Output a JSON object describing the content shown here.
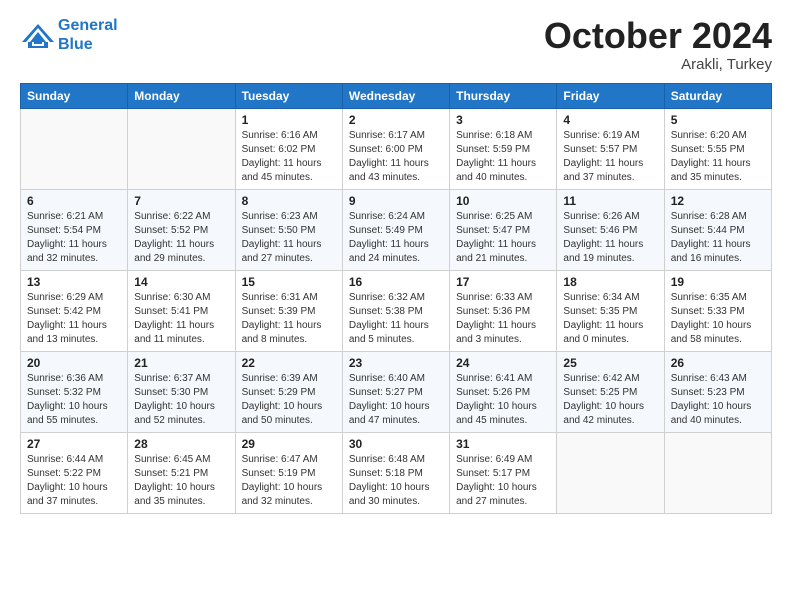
{
  "header": {
    "logo_line1": "General",
    "logo_line2": "Blue",
    "month_title": "October 2024",
    "location": "Arakli, Turkey"
  },
  "columns": [
    "Sunday",
    "Monday",
    "Tuesday",
    "Wednesday",
    "Thursday",
    "Friday",
    "Saturday"
  ],
  "weeks": [
    [
      {
        "day": "",
        "info": ""
      },
      {
        "day": "",
        "info": ""
      },
      {
        "day": "1",
        "info": "Sunrise: 6:16 AM\nSunset: 6:02 PM\nDaylight: 11 hours and 45 minutes."
      },
      {
        "day": "2",
        "info": "Sunrise: 6:17 AM\nSunset: 6:00 PM\nDaylight: 11 hours and 43 minutes."
      },
      {
        "day": "3",
        "info": "Sunrise: 6:18 AM\nSunset: 5:59 PM\nDaylight: 11 hours and 40 minutes."
      },
      {
        "day": "4",
        "info": "Sunrise: 6:19 AM\nSunset: 5:57 PM\nDaylight: 11 hours and 37 minutes."
      },
      {
        "day": "5",
        "info": "Sunrise: 6:20 AM\nSunset: 5:55 PM\nDaylight: 11 hours and 35 minutes."
      }
    ],
    [
      {
        "day": "6",
        "info": "Sunrise: 6:21 AM\nSunset: 5:54 PM\nDaylight: 11 hours and 32 minutes."
      },
      {
        "day": "7",
        "info": "Sunrise: 6:22 AM\nSunset: 5:52 PM\nDaylight: 11 hours and 29 minutes."
      },
      {
        "day": "8",
        "info": "Sunrise: 6:23 AM\nSunset: 5:50 PM\nDaylight: 11 hours and 27 minutes."
      },
      {
        "day": "9",
        "info": "Sunrise: 6:24 AM\nSunset: 5:49 PM\nDaylight: 11 hours and 24 minutes."
      },
      {
        "day": "10",
        "info": "Sunrise: 6:25 AM\nSunset: 5:47 PM\nDaylight: 11 hours and 21 minutes."
      },
      {
        "day": "11",
        "info": "Sunrise: 6:26 AM\nSunset: 5:46 PM\nDaylight: 11 hours and 19 minutes."
      },
      {
        "day": "12",
        "info": "Sunrise: 6:28 AM\nSunset: 5:44 PM\nDaylight: 11 hours and 16 minutes."
      }
    ],
    [
      {
        "day": "13",
        "info": "Sunrise: 6:29 AM\nSunset: 5:42 PM\nDaylight: 11 hours and 13 minutes."
      },
      {
        "day": "14",
        "info": "Sunrise: 6:30 AM\nSunset: 5:41 PM\nDaylight: 11 hours and 11 minutes."
      },
      {
        "day": "15",
        "info": "Sunrise: 6:31 AM\nSunset: 5:39 PM\nDaylight: 11 hours and 8 minutes."
      },
      {
        "day": "16",
        "info": "Sunrise: 6:32 AM\nSunset: 5:38 PM\nDaylight: 11 hours and 5 minutes."
      },
      {
        "day": "17",
        "info": "Sunrise: 6:33 AM\nSunset: 5:36 PM\nDaylight: 11 hours and 3 minutes."
      },
      {
        "day": "18",
        "info": "Sunrise: 6:34 AM\nSunset: 5:35 PM\nDaylight: 11 hours and 0 minutes."
      },
      {
        "day": "19",
        "info": "Sunrise: 6:35 AM\nSunset: 5:33 PM\nDaylight: 10 hours and 58 minutes."
      }
    ],
    [
      {
        "day": "20",
        "info": "Sunrise: 6:36 AM\nSunset: 5:32 PM\nDaylight: 10 hours and 55 minutes."
      },
      {
        "day": "21",
        "info": "Sunrise: 6:37 AM\nSunset: 5:30 PM\nDaylight: 10 hours and 52 minutes."
      },
      {
        "day": "22",
        "info": "Sunrise: 6:39 AM\nSunset: 5:29 PM\nDaylight: 10 hours and 50 minutes."
      },
      {
        "day": "23",
        "info": "Sunrise: 6:40 AM\nSunset: 5:27 PM\nDaylight: 10 hours and 47 minutes."
      },
      {
        "day": "24",
        "info": "Sunrise: 6:41 AM\nSunset: 5:26 PM\nDaylight: 10 hours and 45 minutes."
      },
      {
        "day": "25",
        "info": "Sunrise: 6:42 AM\nSunset: 5:25 PM\nDaylight: 10 hours and 42 minutes."
      },
      {
        "day": "26",
        "info": "Sunrise: 6:43 AM\nSunset: 5:23 PM\nDaylight: 10 hours and 40 minutes."
      }
    ],
    [
      {
        "day": "27",
        "info": "Sunrise: 6:44 AM\nSunset: 5:22 PM\nDaylight: 10 hours and 37 minutes."
      },
      {
        "day": "28",
        "info": "Sunrise: 6:45 AM\nSunset: 5:21 PM\nDaylight: 10 hours and 35 minutes."
      },
      {
        "day": "29",
        "info": "Sunrise: 6:47 AM\nSunset: 5:19 PM\nDaylight: 10 hours and 32 minutes."
      },
      {
        "day": "30",
        "info": "Sunrise: 6:48 AM\nSunset: 5:18 PM\nDaylight: 10 hours and 30 minutes."
      },
      {
        "day": "31",
        "info": "Sunrise: 6:49 AM\nSunset: 5:17 PM\nDaylight: 10 hours and 27 minutes."
      },
      {
        "day": "",
        "info": ""
      },
      {
        "day": "",
        "info": ""
      }
    ]
  ]
}
